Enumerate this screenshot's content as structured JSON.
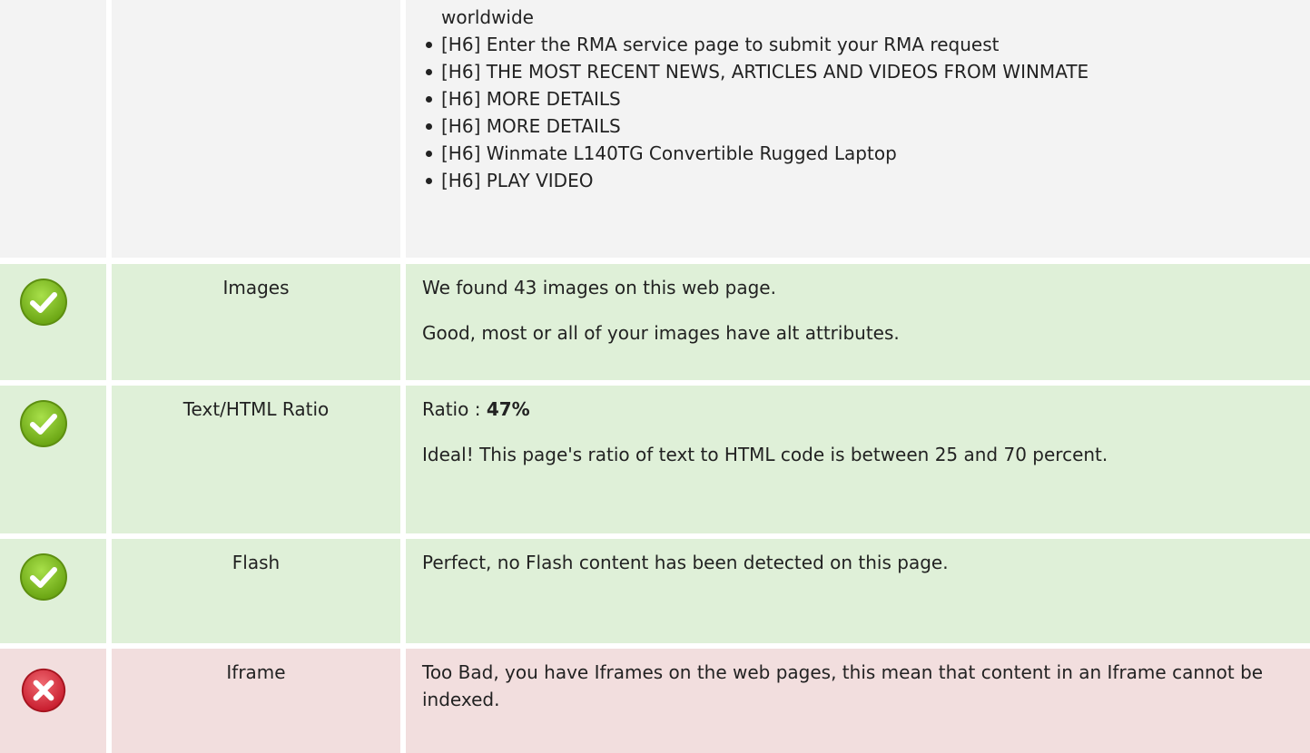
{
  "headings_section": {
    "continued_text": "worldwide",
    "items": [
      "[H6] Enter the RMA service page to submit your RMA request",
      "[H6] THE MOST RECENT NEWS, ARTICLES AND VIDEOS FROM WINMATE",
      "[H6] MORE DETAILS",
      "[H6] MORE DETAILS",
      "[H6] Winmate L140TG Convertible Rugged Laptop",
      "[H6] PLAY VIDEO"
    ]
  },
  "rows": [
    {
      "status": "pass",
      "icon": "check-circle-icon",
      "name": "Images",
      "lines": [
        "We found 43 images on this web page.",
        "Good, most or all of your images have alt attributes."
      ]
    },
    {
      "status": "pass",
      "icon": "check-circle-icon",
      "name": "Text/HTML Ratio",
      "ratio_label": "Ratio : ",
      "ratio_value": "47%",
      "lines": [
        "Ideal! This page's ratio of text to HTML code is between 25 and 70 percent."
      ]
    },
    {
      "status": "pass",
      "icon": "check-circle-icon",
      "name": "Flash",
      "lines": [
        "Perfect, no Flash content has been detected on this page."
      ]
    },
    {
      "status": "fail",
      "icon": "error-circle-icon",
      "name": "Iframe",
      "lines": [
        "Too Bad, you have Iframes on the web pages, this mean that content in an Iframe cannot be indexed."
      ]
    }
  ],
  "colors": {
    "pass_background": "#dff0d8",
    "fail_background": "#f2dede",
    "neutral_background": "#f3f3f3",
    "pass_icon": "#7cb518",
    "fail_icon": "#d9263a"
  }
}
